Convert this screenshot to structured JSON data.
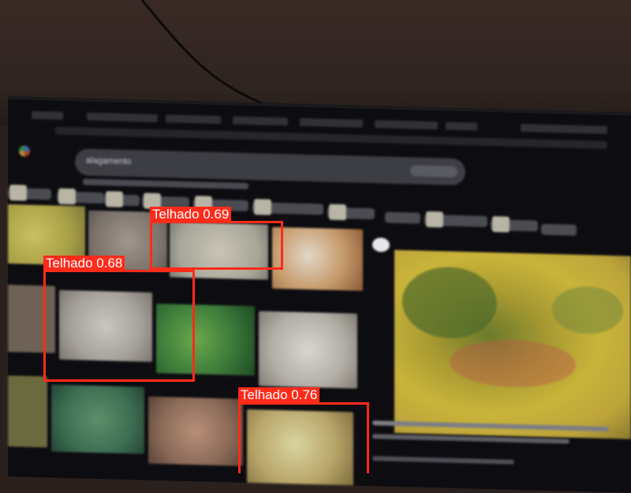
{
  "detections": [
    {
      "label": "Telhado 0.69",
      "class": "Telhado",
      "confidence": 0.69
    },
    {
      "label": "Telhado 0.68",
      "class": "Telhado",
      "confidence": 0.68
    },
    {
      "label": "Telhado 0.76",
      "class": "Telhado",
      "confidence": 0.76
    }
  ],
  "colors": {
    "box": "#ff2b1a",
    "label_text": "#ffffff",
    "monitor_bg": "#0d0c10",
    "wall": "#3a2a26"
  },
  "screen": {
    "search_text": "alagamento"
  }
}
